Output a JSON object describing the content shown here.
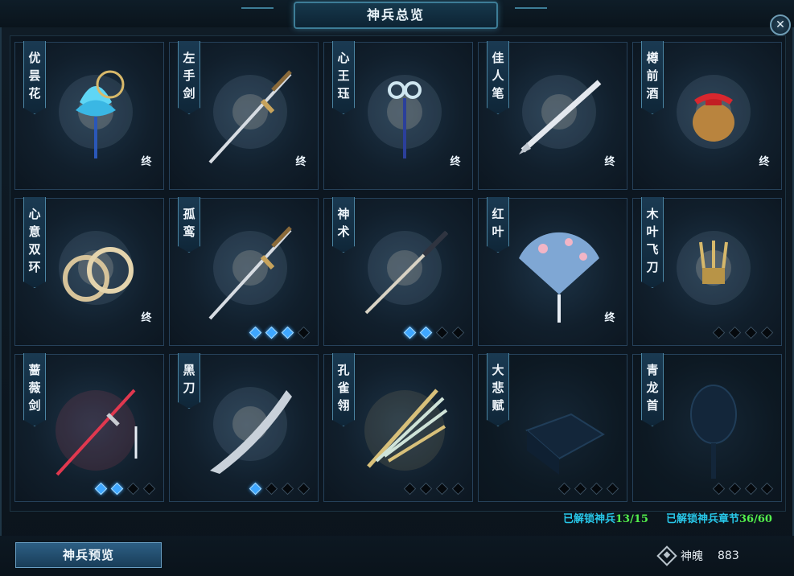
{
  "window": {
    "title": "神兵总览",
    "close_glyph": "✕"
  },
  "cards": [
    {
      "name": "优昙花",
      "chars": [
        "优",
        "昙",
        "花"
      ],
      "state": "final",
      "badge": "终",
      "stars": [],
      "icon": "lotus-icon"
    },
    {
      "name": "左手剑",
      "chars": [
        "左",
        "手",
        "剑"
      ],
      "state": "final",
      "badge": "终",
      "stars": [],
      "icon": "sword-icon"
    },
    {
      "name": "心王珏",
      "chars": [
        "心",
        "王",
        "珏"
      ],
      "state": "final",
      "badge": "终",
      "stars": [],
      "icon": "jade-pendant-icon"
    },
    {
      "name": "佳人笔",
      "chars": [
        "佳",
        "人",
        "笔"
      ],
      "state": "final",
      "badge": "终",
      "stars": [],
      "icon": "brush-icon"
    },
    {
      "name": "樽前酒",
      "chars": [
        "樽",
        "前",
        "酒"
      ],
      "state": "final",
      "badge": "终",
      "stars": [],
      "icon": "wine-jar-icon"
    },
    {
      "name": "心意双环",
      "chars": [
        "心",
        "意",
        "双",
        "环"
      ],
      "state": "final",
      "badge": "终",
      "stars": [],
      "icon": "twin-rings-icon"
    },
    {
      "name": "孤鸾",
      "chars": [
        "孤",
        "鸾"
      ],
      "state": "stars",
      "badge": "",
      "stars": [
        1,
        1,
        1,
        0
      ],
      "icon": "sword-icon"
    },
    {
      "name": "神术",
      "chars": [
        "神",
        "术"
      ],
      "state": "stars",
      "badge": "",
      "stars": [
        1,
        1,
        0,
        0
      ],
      "icon": "katana-icon"
    },
    {
      "name": "红叶",
      "chars": [
        "红",
        "叶"
      ],
      "state": "final",
      "badge": "终",
      "stars": [],
      "icon": "fan-icon"
    },
    {
      "name": "木叶飞刀",
      "chars": [
        "木",
        "叶",
        "飞",
        "刀"
      ],
      "state": "stars",
      "badge": "",
      "stars": [
        0,
        0,
        0,
        0
      ],
      "icon": "flying-knives-icon"
    },
    {
      "name": "蔷薇剑",
      "chars": [
        "蔷",
        "薇",
        "剑"
      ],
      "state": "stars",
      "badge": "",
      "stars": [
        1,
        1,
        0,
        0
      ],
      "icon": "rose-sword-icon"
    },
    {
      "name": "黑刀",
      "chars": [
        "黑",
        "刀"
      ],
      "state": "stars",
      "badge": "",
      "stars": [
        1,
        0,
        0,
        0
      ],
      "icon": "blade-icon"
    },
    {
      "name": "孔雀翎",
      "chars": [
        "孔",
        "雀",
        "翎"
      ],
      "state": "stars",
      "badge": "",
      "stars": [
        0,
        0,
        0,
        0
      ],
      "icon": "peacock-feather-icon"
    },
    {
      "name": "大悲赋",
      "chars": [
        "大",
        "悲",
        "赋"
      ],
      "state": "locked",
      "badge": "",
      "stars": [
        0,
        0,
        0,
        0
      ],
      "icon": "book-silhouette-icon"
    },
    {
      "name": "青龙首",
      "chars": [
        "青",
        "龙",
        "首"
      ],
      "state": "locked",
      "badge": "",
      "stars": [
        0,
        0,
        0,
        0
      ],
      "icon": "dragon-head-silhouette-icon"
    }
  ],
  "status": {
    "weapons_label": "已解锁神兵",
    "weapons_value": "13/15",
    "chapters_label": "已解锁神兵章节",
    "chapters_value": "36/60"
  },
  "footer": {
    "preview_button": "神兵预览",
    "currency_label": "神魄",
    "currency_value": "883"
  },
  "colors": {
    "accent": "#28c7e8",
    "highlight": "#53f04c",
    "star_on": "#3fa7ff"
  }
}
